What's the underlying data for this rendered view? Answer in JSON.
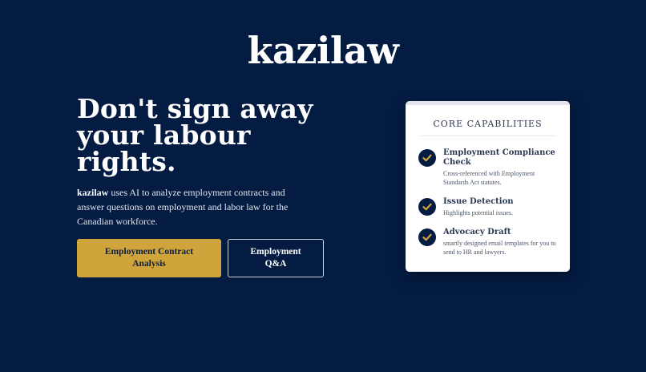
{
  "brand": "kazilaw",
  "hero": {
    "headline": [
      "Don't sign away",
      "your labour",
      "rights."
    ],
    "description_brand": "kazilaw",
    "description_rest": " uses AI to analyze employment contracts and answer questions on employment and labor law for the Canadian workforce."
  },
  "buttons": {
    "primary": "Employment Contract Analysis",
    "secondary": "Employment Q&A"
  },
  "capabilities": {
    "title": "CORE CAPABILITIES",
    "items": [
      {
        "title": "Employment Compliance Check",
        "desc": "Cross-referenced with Employment Standards Act statutes."
      },
      {
        "title": "Issue Detection",
        "desc": "Highlights potential issues."
      },
      {
        "title": "Advocacy Draft",
        "desc": "smartly designed email templates for you to send to HR and lawyers."
      }
    ]
  },
  "colors": {
    "background": "#041c42",
    "accent": "#cfa43a",
    "card": "#ffffff"
  },
  "icons": {
    "capability_marker": "check-circle-icon"
  }
}
